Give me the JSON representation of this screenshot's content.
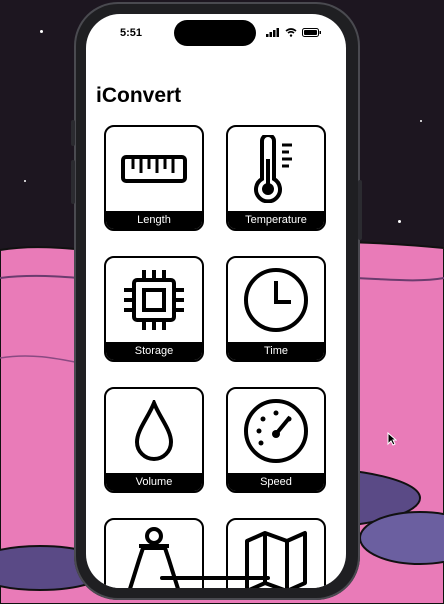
{
  "status_bar": {
    "time": "5:51"
  },
  "app": {
    "title": "iConvert"
  },
  "tiles": [
    {
      "label": "Length",
      "icon": "ruler-icon"
    },
    {
      "label": "Temperature",
      "icon": "thermometer-icon"
    },
    {
      "label": "Storage",
      "icon": "chip-icon"
    },
    {
      "label": "Time",
      "icon": "clock-icon"
    },
    {
      "label": "Volume",
      "icon": "droplet-icon"
    },
    {
      "label": "Speed",
      "icon": "speedometer-icon"
    },
    {
      "label": "",
      "icon": "weight-icon"
    },
    {
      "label": "",
      "icon": "map-icon"
    }
  ],
  "colors": {
    "tile_border": "#000000",
    "label_bg": "#000000",
    "label_text": "#ffffff",
    "background_pink": "#e97bb8"
  }
}
